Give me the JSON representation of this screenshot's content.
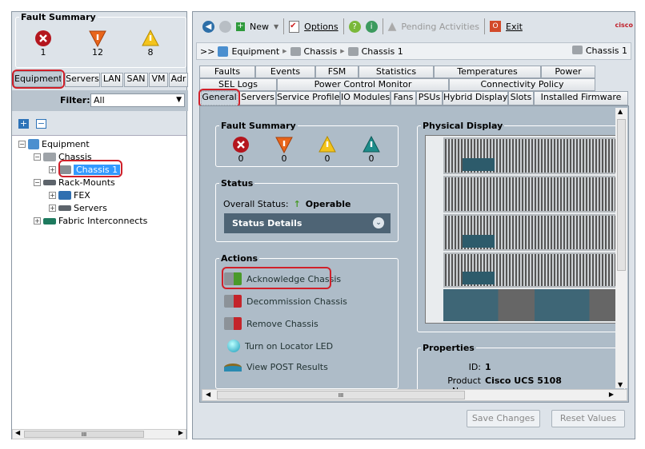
{
  "left": {
    "fault_summary": {
      "title": "Fault Summary",
      "critical": "1",
      "major": "12",
      "minor": "8"
    },
    "tabs": [
      "Equipment",
      "Servers",
      "LAN",
      "SAN",
      "VM",
      "Adr"
    ],
    "filter_label": "Filter:",
    "filter_value": "All",
    "tree": [
      {
        "label": "Equipment"
      },
      {
        "label": "Chassis"
      },
      {
        "label": "Chassis 1"
      },
      {
        "label": "Rack-Mounts"
      },
      {
        "label": "FEX"
      },
      {
        "label": "Servers"
      },
      {
        "label": "Fabric Interconnects"
      }
    ],
    "scroll_label": "III"
  },
  "toolbar": {
    "new": "New",
    "options": "Options",
    "pending": "Pending Activities",
    "exit": "Exit",
    "brand": "cisco"
  },
  "breadcrumb": {
    "prefix": ">>",
    "items": [
      "Equipment",
      "Chassis",
      "Chassis 1"
    ],
    "current": "Chassis 1"
  },
  "tabs": {
    "row1": [
      "Faults",
      "Events",
      "FSM",
      "Statistics",
      "Temperatures",
      "Power"
    ],
    "row2": [
      "SEL Logs",
      "Power Control Monitor",
      "Connectivity Policy"
    ],
    "row3": [
      "General",
      "Servers",
      "Service Profiles",
      "IO Modules",
      "Fans",
      "PSUs",
      "Hybrid Display",
      "Slots",
      "Installed Firmware"
    ]
  },
  "general": {
    "fault_summary": {
      "title": "Fault Summary",
      "counts": [
        "0",
        "0",
        "0",
        "0"
      ]
    },
    "status": {
      "title": "Status",
      "label": "Overall Status:",
      "value": "Operable",
      "details": "Status Details"
    },
    "actions": {
      "title": "Actions",
      "items": [
        "Acknowledge Chassis",
        "Decommission Chassis",
        "Remove Chassis",
        "Turn on Locator LED",
        "View POST Results"
      ]
    },
    "physical_display": {
      "title": "Physical Display"
    },
    "properties": {
      "title": "Properties",
      "id_label": "ID:",
      "id_value": "1",
      "product_label": "Product Name:",
      "product_value": "Cisco UCS 5108"
    },
    "scroll_label": "III"
  },
  "buttons": {
    "save": "Save Changes",
    "reset": "Reset Values"
  },
  "colors": {
    "panel": "#c9d3dc",
    "highlight": "#d0202a",
    "select": "#3399ff"
  }
}
